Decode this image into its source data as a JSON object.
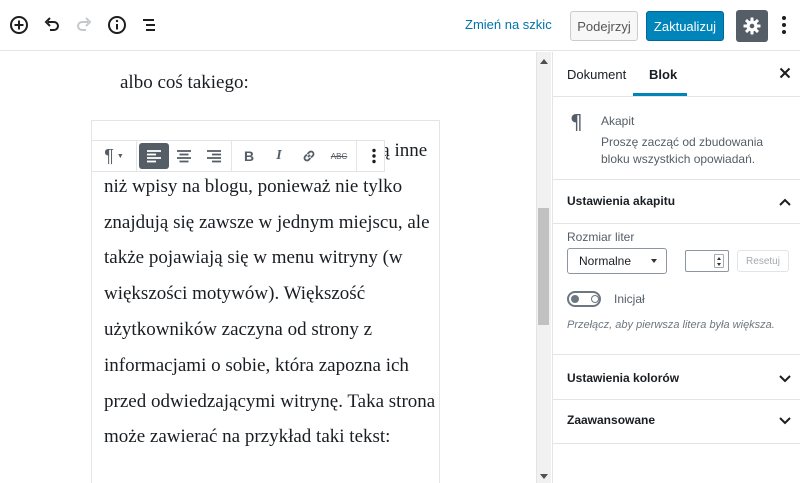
{
  "header": {
    "switch_to_draft": "Zmień na szkic",
    "preview": "Podejrzyj",
    "update": "Zaktualizuj"
  },
  "editor": {
    "previous_text": "albo coś takiego:",
    "paragraph": "To jest przykładowa strona. Strony są inne niż wpisy na blogu, ponieważ nie tylko znajdują się zawsze w jednym miejscu, ale także pojawiają się w menu witryny (w większości motywów). Większość użytkowników zaczyna od strony z informacjami o sobie, która zapozna ich przed odwiedzającymi witrynę. Taka strona może zawierać na przykład taki tekst:"
  },
  "toolbar": {
    "paragraph_icon": "¶",
    "bold": "B",
    "italic": "I",
    "strikethrough": "ABC"
  },
  "sidebar": {
    "tabs": [
      {
        "label": "Dokument",
        "active": false
      },
      {
        "label": "Blok",
        "active": true
      }
    ],
    "block_card": {
      "icon": "¶",
      "title": "Akapit",
      "description": "Proszę zacząć od zbudowania bloku wszystkich opowiadań."
    },
    "paragraph_settings": {
      "title": "Ustawienia akapitu",
      "expanded": true,
      "font_size_label": "Rozmiar liter",
      "font_size_value": "Normalne",
      "custom_size_value": "",
      "reset": "Resetuj",
      "drop_cap_label": "Inicjał",
      "drop_cap_enabled": false,
      "drop_cap_help": "Przełącz, aby pierwsza litera była większa."
    },
    "color_settings": {
      "title": "Ustawienia kolorów",
      "expanded": false
    },
    "advanced": {
      "title": "Zaawansowane",
      "expanded": false
    }
  },
  "colors": {
    "accent": "#0085ba",
    "link": "#0073aa",
    "settings_button": "#555d66"
  },
  "icons": [
    "add-block-icon",
    "undo-icon",
    "redo-icon",
    "info-icon",
    "outline-icon",
    "gear-icon",
    "more-vertical-icon",
    "close-icon",
    "chevron-up-icon",
    "chevron-down-icon",
    "paragraph-icon",
    "align-left-icon",
    "align-center-icon",
    "align-right-icon",
    "link-icon"
  ]
}
